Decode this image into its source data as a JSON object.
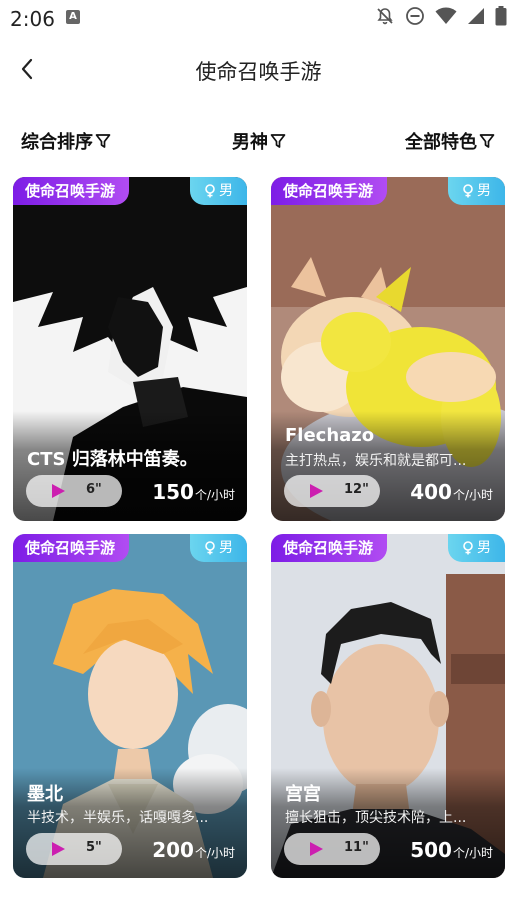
{
  "status": {
    "time": "2:06",
    "notification_icon": "A"
  },
  "header": {
    "title": "使命召唤手游"
  },
  "filters": [
    {
      "label": "综合排序"
    },
    {
      "label": "男神"
    },
    {
      "label": "全部特色"
    }
  ],
  "cards": [
    {
      "game": "使命召唤手游",
      "gender": "男",
      "name": "CTS 归落林中笛奏。",
      "desc": "",
      "duration": "6\"",
      "price": "150",
      "unit": "个/小时",
      "photo": "manga-portrait"
    },
    {
      "game": "使命召唤手游",
      "gender": "男",
      "name": "Flechazo",
      "desc": "主打热点，娱乐和就是都可...",
      "duration": "12\"",
      "price": "400",
      "unit": "个/小时",
      "photo": "puppy-with-toy"
    },
    {
      "game": "使命召唤手游",
      "gender": "男",
      "name": "墨北",
      "desc": "半技术，半娱乐，话嘎嘎多...",
      "duration": "5\"",
      "price": "200",
      "unit": "个/小时",
      "photo": "anime-boy-sky"
    },
    {
      "game": "使命召唤手游",
      "gender": "男",
      "name": "宫宫",
      "desc": "擅长狙击，顶尖技术陪，上...",
      "duration": "11\"",
      "price": "500",
      "unit": "个/小时",
      "photo": "selfie-photo"
    }
  ],
  "colors": {
    "game_tag": "#8a27ea",
    "gender_tag": "#4dc2ec",
    "play": "#cc1fb0"
  }
}
